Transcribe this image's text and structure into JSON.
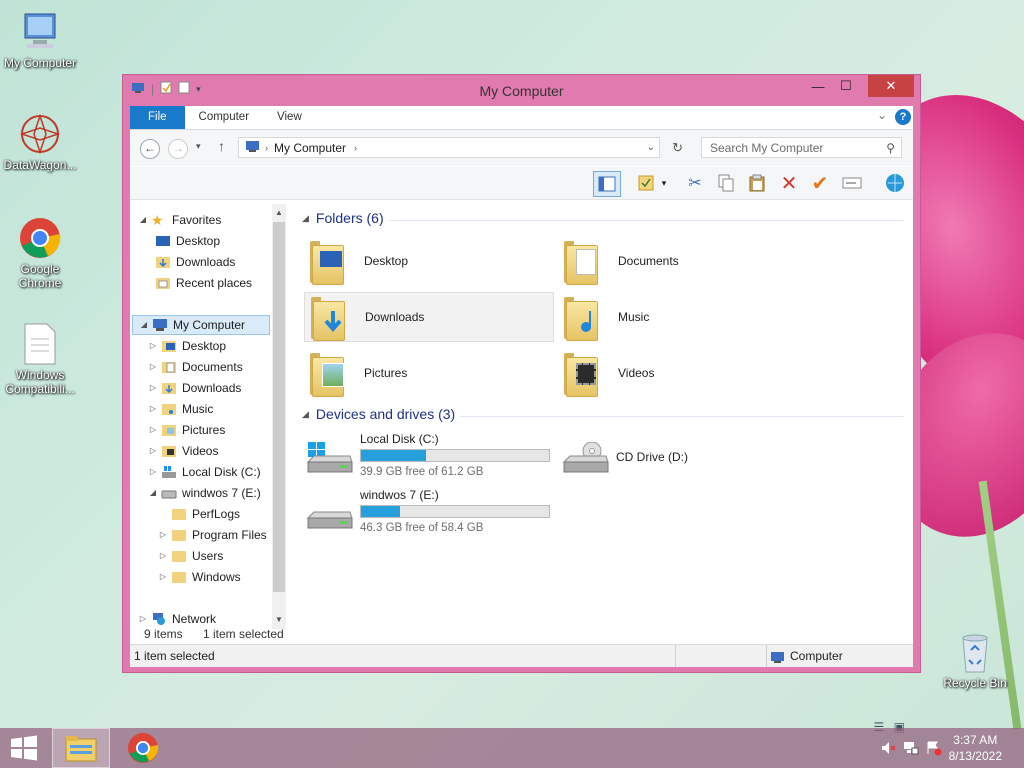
{
  "desktop": {
    "icons": [
      {
        "label": "My Computer",
        "icon": "computer-icon"
      },
      {
        "label": "DataWagon...",
        "icon": "datawagon-icon"
      },
      {
        "label": "Google Chrome",
        "icon": "chrome-icon"
      },
      {
        "label": "Windows Compatibili...",
        "icon": "document-icon"
      },
      {
        "label": "Recycle Bin",
        "icon": "recycle-bin-icon"
      }
    ]
  },
  "window": {
    "title": "My Computer",
    "close_glyph": "✕",
    "min_glyph": "—",
    "max_glyph": "☐"
  },
  "ribbon": {
    "tabs": [
      "File",
      "Computer",
      "View"
    ],
    "help": "?"
  },
  "address": {
    "path": "My Computer",
    "search_placeholder": "Search My Computer"
  },
  "nav": {
    "favorites": "Favorites",
    "fav_items": [
      "Desktop",
      "Downloads",
      "Recent places"
    ],
    "computer": "My Computer",
    "computer_items": [
      "Desktop",
      "Documents",
      "Downloads",
      "Music",
      "Pictures",
      "Videos",
      "Local Disk (C:)",
      "windwos 7 (E:)"
    ],
    "e_items": [
      "PerfLogs",
      "Program Files",
      "Users",
      "Windows"
    ],
    "network": "Network"
  },
  "content": {
    "folders_header": "Folders (6)",
    "folders": [
      "Desktop",
      "Documents",
      "Downloads",
      "Music",
      "Pictures",
      "Videos"
    ],
    "devices_header": "Devices and drives (3)",
    "drives": [
      {
        "name": "Local Disk (C:)",
        "free": "39.9 GB free of 61.2 GB",
        "used_fraction": 0.348
      },
      {
        "name": "windwos 7 (E:)",
        "free": "46.3 GB free of 58.4 GB",
        "used_fraction": 0.207
      }
    ],
    "cd_drive": "CD Drive (D:)"
  },
  "status": {
    "items_count": "9 items",
    "items_selected": "1 item selected",
    "bottom_left": "1 item selected",
    "bottom_right": "Computer"
  },
  "taskbar": {
    "time": "3:37 AM",
    "date": "8/13/2022"
  },
  "colors": {
    "accent": "#1979ca",
    "window_frame": "#e17aae",
    "drive_bar": "#26a0da"
  }
}
